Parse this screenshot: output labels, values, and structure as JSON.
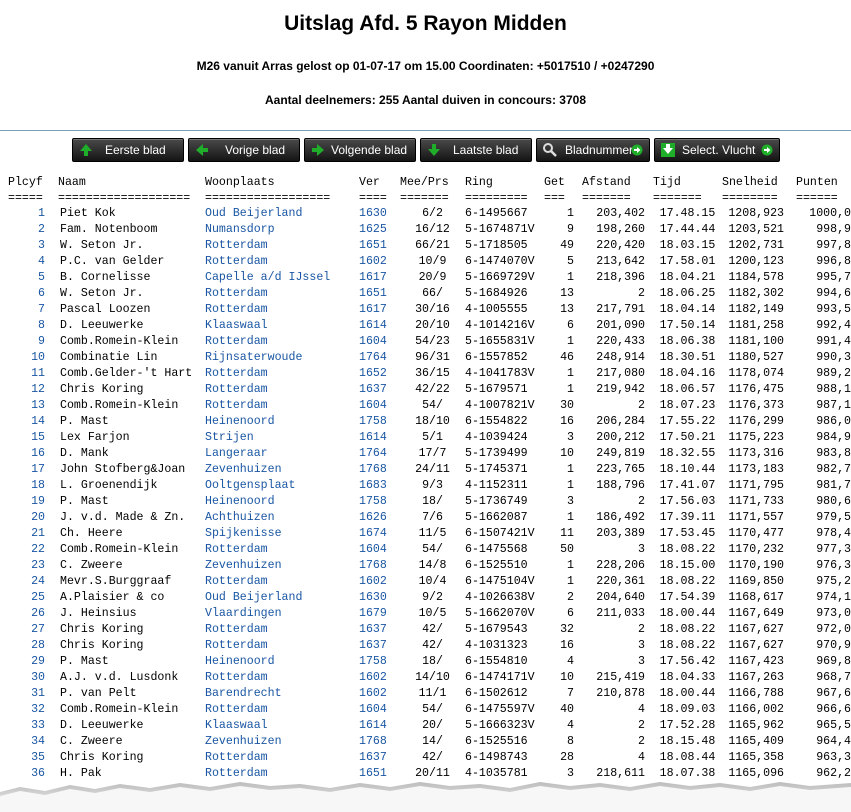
{
  "header": {
    "title": "Uitslag Afd. 5 Rayon Midden",
    "flight_info": "M26 vanuit Arras gelost op 01-07-17 om 15.00 Coordinaten: +5017510 / +0247290",
    "participants_info": "Aantal deelnemers: 255 Aantal duiven in concours: 3708"
  },
  "nav": {
    "buttons": [
      {
        "label": "Eerste blad",
        "icon": "arrow-up-icon"
      },
      {
        "label": "Vorige blad",
        "icon": "arrow-left-icon"
      },
      {
        "label": "Volgende blad",
        "icon": "arrow-right-icon"
      },
      {
        "label": "Laatste blad",
        "icon": "arrow-down-icon"
      },
      {
        "label": "Bladnummer",
        "icon": "magnifier-icon"
      },
      {
        "label": "Select. Vlucht",
        "icon": "select-check-icon"
      }
    ]
  },
  "table": {
    "columns": [
      "Plcyf",
      "Naam",
      "Woonplaats",
      "Ver",
      "Mee/Prs",
      "Ring",
      "Get",
      "Afstand",
      "Tijd",
      "Snelheid",
      "Punten"
    ],
    "separators": [
      "=====",
      "===================",
      "==================",
      "====",
      "=======",
      "=========",
      "===",
      "=======",
      "=======",
      "========",
      "======"
    ],
    "rows": [
      [
        "1",
        "Piet Kok",
        "Oud Beijerland",
        "1630",
        "6/2",
        "6-1495667",
        "1",
        "203,402",
        "17.48.15",
        "1208,923",
        "1000,0"
      ],
      [
        "2",
        "Fam. Notenboom",
        "Numansdorp",
        "1625",
        "16/12",
        "5-1674871V",
        "9",
        "198,260",
        "17.44.44",
        "1203,521",
        "998,9"
      ],
      [
        "3",
        "W. Seton Jr.",
        "Rotterdam",
        "1651",
        "66/21",
        "5-1718505",
        "49",
        "220,420",
        "18.03.15",
        "1202,731",
        "997,8"
      ],
      [
        "4",
        "P.C. van Gelder",
        "Rotterdam",
        "1602",
        "10/9",
        "6-1474070V",
        "5",
        "213,642",
        "17.58.01",
        "1200,123",
        "996,8"
      ],
      [
        "5",
        "B. Cornelisse",
        "Capelle a/d IJssel",
        "1617",
        "20/9",
        "5-1669729V",
        "1",
        "218,396",
        "18.04.21",
        "1184,578",
        "995,7"
      ],
      [
        "6",
        "W. Seton Jr.",
        "Rotterdam",
        "1651",
        "66/",
        "5-1684926",
        "13",
        "2",
        "18.06.25",
        "1182,302",
        "994,6"
      ],
      [
        "7",
        "Pascal Loozen",
        "Rotterdam",
        "1617",
        "30/16",
        "4-1005555",
        "13",
        "217,791",
        "18.04.14",
        "1182,149",
        "993,5"
      ],
      [
        "8",
        "D. Leeuwerke",
        "Klaaswaal",
        "1614",
        "20/10",
        "4-1014216V",
        "6",
        "201,090",
        "17.50.14",
        "1181,258",
        "992,4"
      ],
      [
        "9",
        "Comb.Romein-Klein",
        "Rotterdam",
        "1604",
        "54/23",
        "5-1655831V",
        "1",
        "220,433",
        "18.06.38",
        "1181,100",
        "991,4"
      ],
      [
        "10",
        "Combinatie Lin",
        "Rijnsaterwoude",
        "1764",
        "96/31",
        "6-1557852",
        "46",
        "248,914",
        "18.30.51",
        "1180,527",
        "990,3"
      ],
      [
        "11",
        "Comb.Gelder-'t Hart",
        "Rotterdam",
        "1652",
        "36/15",
        "4-1041783V",
        "1",
        "217,080",
        "18.04.16",
        "1178,074",
        "989,2"
      ],
      [
        "12",
        "Chris Koring",
        "Rotterdam",
        "1637",
        "42/22",
        "5-1679571",
        "1",
        "219,942",
        "18.06.57",
        "1176,475",
        "988,1"
      ],
      [
        "13",
        "Comb.Romein-Klein",
        "Rotterdam",
        "1604",
        "54/",
        "4-1007821V",
        "30",
        "2",
        "18.07.23",
        "1176,373",
        "987,1"
      ],
      [
        "14",
        "P. Mast",
        "Heinenoord",
        "1758",
        "18/10",
        "6-1554822",
        "16",
        "206,284",
        "17.55.22",
        "1176,299",
        "986,0"
      ],
      [
        "15",
        "Lex Farjon",
        "Strijen",
        "1614",
        "5/1",
        "4-1039424",
        "3",
        "200,212",
        "17.50.21",
        "1175,223",
        "984,9"
      ],
      [
        "16",
        "D. Mank",
        "Langeraar",
        "1764",
        "17/7",
        "5-1739499",
        "10",
        "249,819",
        "18.32.55",
        "1173,316",
        "983,8"
      ],
      [
        "17",
        "John Stofberg&Joan",
        "Zevenhuizen",
        "1768",
        "24/11",
        "5-1745371",
        "1",
        "223,765",
        "18.10.44",
        "1173,183",
        "982,7"
      ],
      [
        "18",
        "L. Groenendijk",
        "Ooltgensplaat",
        "1683",
        "9/3",
        "4-1152311",
        "1",
        "188,796",
        "17.41.07",
        "1171,795",
        "981,7"
      ],
      [
        "19",
        "P. Mast",
        "Heinenoord",
        "1758",
        "18/",
        "5-1736749",
        "3",
        "2",
        "17.56.03",
        "1171,733",
        "980,6"
      ],
      [
        "20",
        "J. v.d. Made & Zn.",
        "Achthuizen",
        "1626",
        "7/6",
        "5-1662087",
        "1",
        "186,492",
        "17.39.11",
        "1171,557",
        "979,5"
      ],
      [
        "21",
        "Ch. Heere",
        "Spijkenisse",
        "1674",
        "11/5",
        "6-1507421V",
        "11",
        "203,389",
        "17.53.45",
        "1170,477",
        "978,4"
      ],
      [
        "22",
        "Comb.Romein-Klein",
        "Rotterdam",
        "1604",
        "54/",
        "6-1475568",
        "50",
        "3",
        "18.08.22",
        "1170,232",
        "977,3"
      ],
      [
        "23",
        "C. Zweere",
        "Zevenhuizen",
        "1768",
        "14/8",
        "6-1525510",
        "1",
        "228,206",
        "18.15.00",
        "1170,190",
        "976,3"
      ],
      [
        "24",
        "Mevr.S.Burggraaf",
        "Rotterdam",
        "1602",
        "10/4",
        "6-1475104V",
        "1",
        "220,361",
        "18.08.22",
        "1169,850",
        "975,2"
      ],
      [
        "25",
        "A.Plaisier & co",
        "Oud Beijerland",
        "1630",
        "9/2",
        "4-1026638V",
        "2",
        "204,640",
        "17.54.39",
        "1168,617",
        "974,1"
      ],
      [
        "26",
        "J. Heinsius",
        "Vlaardingen",
        "1679",
        "10/5",
        "5-1662070V",
        "6",
        "211,033",
        "18.00.44",
        "1167,649",
        "973,0"
      ],
      [
        "27",
        "Chris Koring",
        "Rotterdam",
        "1637",
        "42/",
        "5-1679543",
        "32",
        "2",
        "18.08.22",
        "1167,627",
        "972,0"
      ],
      [
        "28",
        "Chris Koring",
        "Rotterdam",
        "1637",
        "42/",
        "4-1031323",
        "16",
        "3",
        "18.08.22",
        "1167,627",
        "970,9"
      ],
      [
        "29",
        "P. Mast",
        "Heinenoord",
        "1758",
        "18/",
        "6-1554810",
        "4",
        "3",
        "17.56.42",
        "1167,423",
        "969,8"
      ],
      [
        "30",
        "A.J. v.d. Lusdonk",
        "Rotterdam",
        "1602",
        "14/10",
        "6-1474171V",
        "10",
        "215,419",
        "18.04.33",
        "1167,263",
        "968,7"
      ],
      [
        "31",
        "P. van Pelt",
        "Barendrecht",
        "1602",
        "11/1",
        "6-1502612",
        "7",
        "210,878",
        "18.00.44",
        "1166,788",
        "967,6"
      ],
      [
        "32",
        "Comb.Romein-Klein",
        "Rotterdam",
        "1604",
        "54/",
        "6-1475597V",
        "40",
        "4",
        "18.09.03",
        "1166,002",
        "966,6"
      ],
      [
        "33",
        "D. Leeuwerke",
        "Klaaswaal",
        "1614",
        "20/",
        "5-1666323V",
        "4",
        "2",
        "17.52.28",
        "1165,962",
        "965,5"
      ],
      [
        "34",
        "C. Zweere",
        "Zevenhuizen",
        "1768",
        "14/",
        "6-1525516",
        "8",
        "2",
        "18.15.48",
        "1165,409",
        "964,4"
      ],
      [
        "35",
        "Chris Koring",
        "Rotterdam",
        "1637",
        "42/",
        "6-1498743",
        "28",
        "4",
        "18.08.44",
        "1165,358",
        "963,3"
      ],
      [
        "36",
        "H. Pak",
        "Rotterdam",
        "1651",
        "20/11",
        "4-1035781",
        "3",
        "218,611",
        "18.07.38",
        "1165,096",
        "962,2"
      ]
    ]
  },
  "colors": {
    "link_blue": "#1a56a3",
    "rule_blue": "#7c9fb9",
    "button_dark": "#1e1e1e",
    "icon_green": "#1fae2a"
  }
}
